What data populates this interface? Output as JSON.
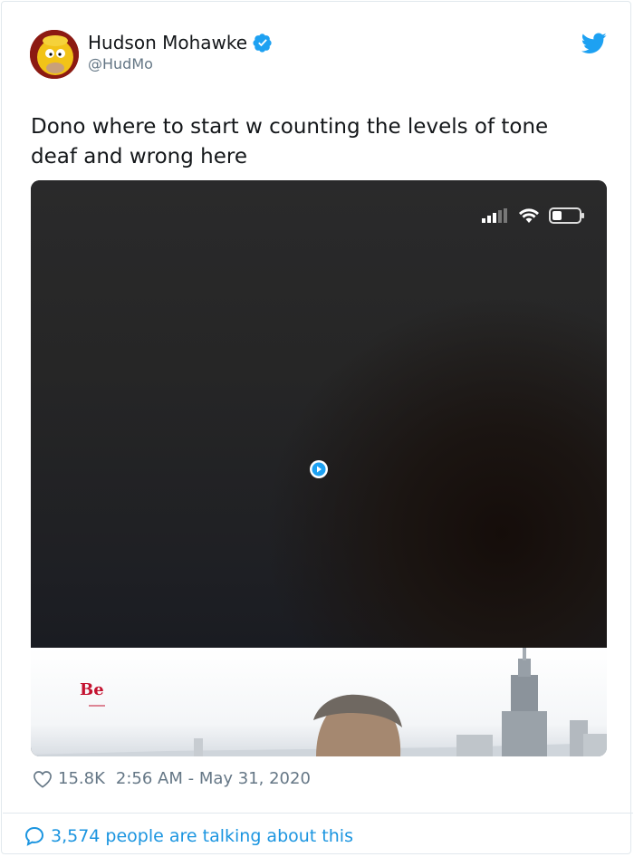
{
  "author": {
    "name": "Hudson Mohawke",
    "handle": "@HudMo",
    "verified": true
  },
  "tweet": {
    "text": "Dono where to start w counting the levels of tone deaf and wrong here"
  },
  "media": {
    "overlay_brand": "Be",
    "has_play_button": true
  },
  "footer": {
    "likes": "15.8K",
    "timestamp": "2:56 AM - May 31, 2020",
    "talking": "3,574 people are talking about this"
  },
  "colors": {
    "twitter_blue": "#1da1f2",
    "link_blue": "#1b95e0",
    "text": "#14171a",
    "muted": "#657786",
    "brand_red": "#c4122f"
  }
}
